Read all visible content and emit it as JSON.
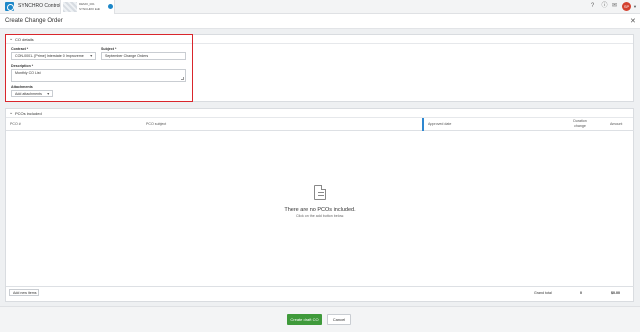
{
  "app": {
    "title": "SYNCHRO Control"
  },
  "project_tab": {
    "line1": "DEMO_001",
    "line2": "SYNCHRO Edit"
  },
  "header_icons": [
    "help-icon",
    "info-icon",
    "notifications-icon"
  ],
  "user": {
    "initials": "SP"
  },
  "page": {
    "title": "Create Change Order"
  },
  "co_details": {
    "section_title": "CO details",
    "contract_label": "Contract *",
    "contract_value": "CON-0001- [Prime] Interstate 0 Improveme",
    "subject_label": "Subject *",
    "subject_value": "September Change Orders",
    "description_label": "Description *",
    "description_value": "Monthly CO List",
    "attachments_label": "Attachments",
    "add_attachments": "Add attachments"
  },
  "pcos": {
    "section_title": "PCOs included",
    "columns": [
      "PCO #",
      "PCO subject",
      "Approved date",
      "Duration change",
      "Amount"
    ],
    "empty_title": "There are no PCOs included.",
    "empty_subtitle": "Click on the add button below.",
    "add_items": "Add new items",
    "grand_total_label": "Grand total",
    "grand_total_duration": "0",
    "grand_total_amount": "$0.00"
  },
  "actions": {
    "primary": "Create draft CO",
    "cancel": "Cancel"
  },
  "colors": {
    "accent": "#1d87c8",
    "primary_button": "#3f9a3b",
    "highlight": "#d9262c",
    "avatar": "#d4412f"
  }
}
